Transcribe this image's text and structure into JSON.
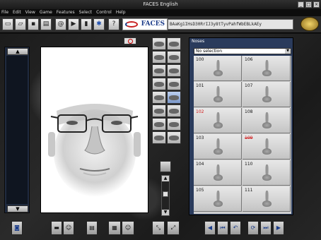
{
  "window": {
    "title": "FACES English"
  },
  "menu": [
    "File",
    "Edit",
    "View",
    "Game",
    "Features",
    "Select",
    "Control",
    "Help"
  ],
  "toolbar": {
    "logo_text": "FACES",
    "face_code": "BAaKg1IHsD30RrIJ3y8tTyvPahfWbEBLkAEy"
  },
  "panel": {
    "title": "Noses",
    "dropdown_value": "No selection",
    "items": [
      {
        "num": "100",
        "style": "normal"
      },
      {
        "num": "106",
        "style": "normal"
      },
      {
        "num": "101",
        "style": "normal"
      },
      {
        "num": "107",
        "style": "normal"
      },
      {
        "num": "102",
        "style": "red"
      },
      {
        "num": "108",
        "style": "normal"
      },
      {
        "num": "103",
        "style": "normal"
      },
      {
        "num": "109",
        "style": "struck"
      },
      {
        "num": "104",
        "style": "normal"
      },
      {
        "num": "110",
        "style": "normal"
      },
      {
        "num": "105",
        "style": "normal"
      },
      {
        "num": "111",
        "style": "normal"
      }
    ]
  },
  "colors": {
    "panel_bg": "#2a3b5c",
    "highlight_red": "#d01818",
    "window_bg": "#151515"
  },
  "icons": [
    "new-icon",
    "open-icon",
    "save-icon",
    "print-icon",
    "spiral-icon",
    "play-icon",
    "cue-icon",
    "snowflake-icon",
    "help-icon",
    "no-icon",
    "trash-icon",
    "arrow-up-icon",
    "arrow-down-icon"
  ]
}
